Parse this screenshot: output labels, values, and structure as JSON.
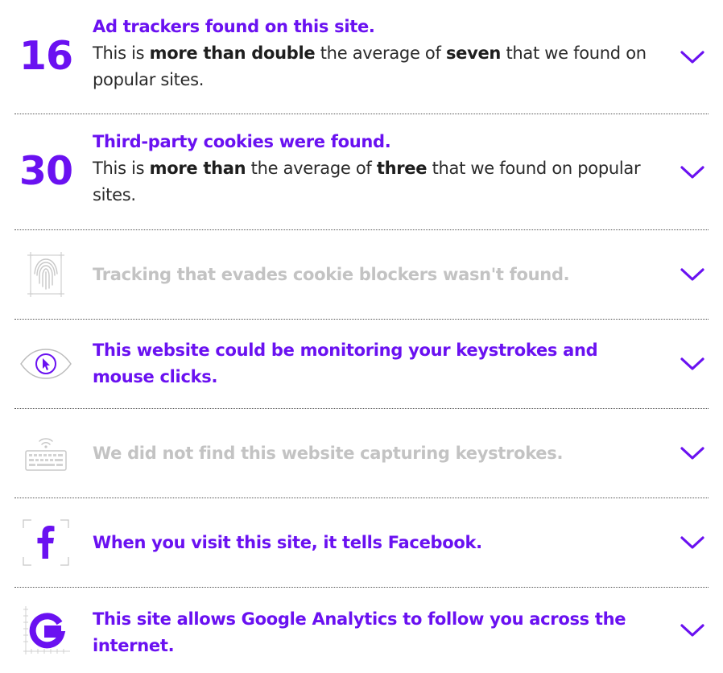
{
  "rows": [
    {
      "kind": "number",
      "number": "16",
      "heading": "Ad trackers found on this site.",
      "desc": {
        "t1": "This is ",
        "b1": "more than double",
        "t2": " the average of ",
        "b2": "seven",
        "t3": " that we found on popular sites."
      }
    },
    {
      "kind": "number",
      "number": "30",
      "heading": "Third-party cookies were found.",
      "desc": {
        "t1": "This is ",
        "b1": "more than",
        "t2": " the average of ",
        "b2": "three",
        "t3": " that we found on popular sites."
      }
    },
    {
      "kind": "icon",
      "icon": "fingerprint-icon",
      "heading": "Tracking that evades cookie blockers wasn't found.",
      "muted": true
    },
    {
      "kind": "icon",
      "icon": "eye-cursor-icon",
      "heading": "This website could be monitoring your keystrokes and mouse clicks.",
      "muted": false
    },
    {
      "kind": "icon",
      "icon": "keyboard-wifi-icon",
      "heading": "We did not find this website capturing keystrokes.",
      "muted": true
    },
    {
      "kind": "icon",
      "icon": "facebook-icon",
      "heading": "When you visit this site, it tells Facebook.",
      "muted": false
    },
    {
      "kind": "icon",
      "icon": "google-icon",
      "heading": "This site allows Google Analytics to follow you across the internet.",
      "muted": false
    }
  ],
  "colors": {
    "accent": "#6a11f1",
    "muted": "#c3c3c3",
    "text": "#2a2a2a",
    "divider": "#555555"
  }
}
